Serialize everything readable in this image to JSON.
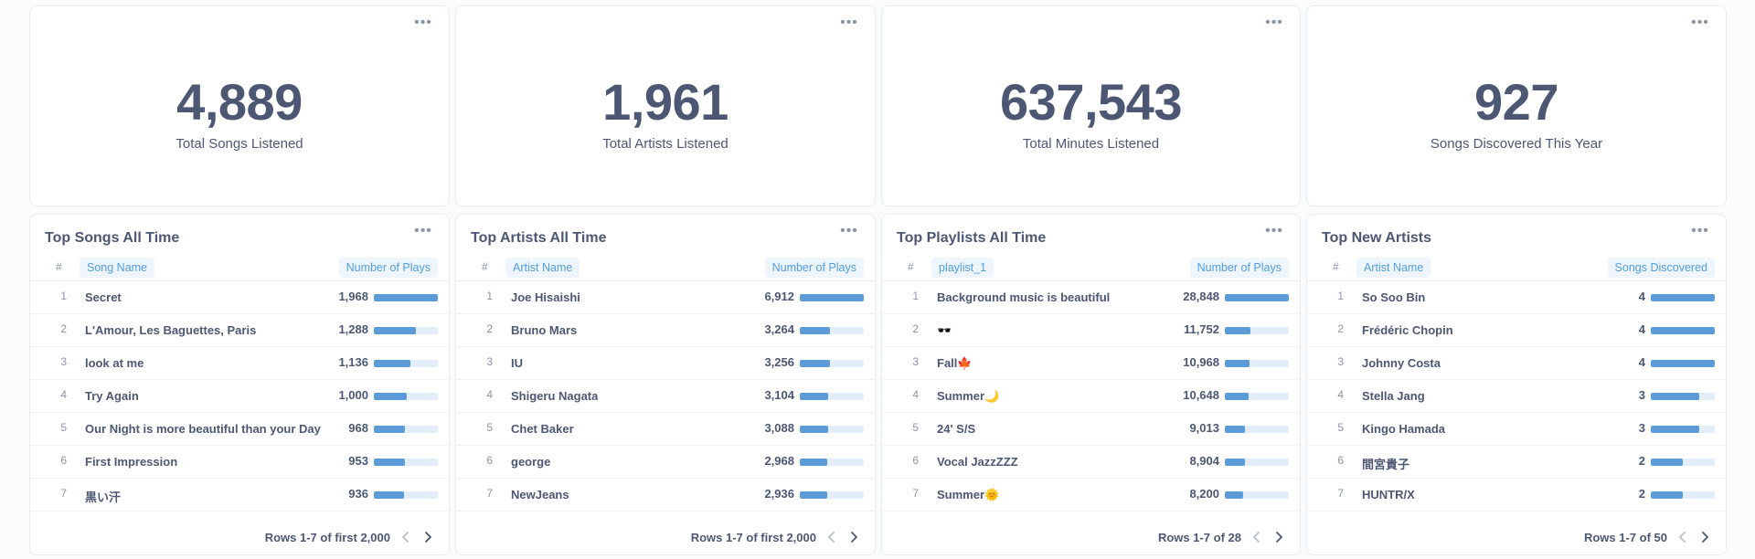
{
  "metrics": [
    {
      "value": "4,889",
      "label": "Total Songs Listened"
    },
    {
      "value": "1,961",
      "label": "Total Artists Listened"
    },
    {
      "value": "637,543",
      "label": "Total Minutes Listened"
    },
    {
      "value": "927",
      "label": "Songs Discovered This Year"
    }
  ],
  "more_icon": "more-horizontal-icon",
  "accent_color": "#509ee3",
  "bar_color": "#5b9bd8",
  "tables": [
    {
      "title": "Top Songs All Time",
      "num_header": "#",
      "name_header": "Song Name",
      "value_header": "Number of Plays",
      "rows": [
        {
          "idx": "1",
          "name": "Secret",
          "value": "1,968",
          "fraction": 1.0
        },
        {
          "idx": "2",
          "name": "L'Amour, Les Baguettes, Paris",
          "value": "1,288",
          "fraction": 0.654
        },
        {
          "idx": "3",
          "name": "look at me",
          "value": "1,136",
          "fraction": 0.577
        },
        {
          "idx": "4",
          "name": "Try Again",
          "value": "1,000",
          "fraction": 0.508
        },
        {
          "idx": "5",
          "name": "Our Night is more beautiful than your Day",
          "value": "968",
          "fraction": 0.492
        },
        {
          "idx": "6",
          "name": "First Impression",
          "value": "953",
          "fraction": 0.484
        },
        {
          "idx": "7",
          "name": "黒い汗",
          "value": "936",
          "fraction": 0.476
        }
      ],
      "footer": "Rows 1-7 of first 2,000"
    },
    {
      "title": "Top Artists All Time",
      "num_header": "#",
      "name_header": "Artist Name",
      "value_header": "Number of Plays",
      "rows": [
        {
          "idx": "1",
          "name": "Joe Hisaishi",
          "value": "6,912",
          "fraction": 1.0
        },
        {
          "idx": "2",
          "name": "Bruno Mars",
          "value": "3,264",
          "fraction": 0.472
        },
        {
          "idx": "3",
          "name": "IU",
          "value": "3,256",
          "fraction": 0.471
        },
        {
          "idx": "4",
          "name": "Shigeru Nagata",
          "value": "3,104",
          "fraction": 0.449
        },
        {
          "idx": "5",
          "name": "Chet Baker",
          "value": "3,088",
          "fraction": 0.447
        },
        {
          "idx": "6",
          "name": "george",
          "value": "2,968",
          "fraction": 0.429
        },
        {
          "idx": "7",
          "name": "NewJeans",
          "value": "2,936",
          "fraction": 0.425
        }
      ],
      "footer": "Rows 1-7 of first 2,000"
    },
    {
      "title": "Top Playlists All Time",
      "num_header": "#",
      "name_header": "playlist_1",
      "value_header": "Number of Plays",
      "rows": [
        {
          "idx": "1",
          "name": "Background music is beautiful",
          "value": "28,848",
          "fraction": 1.0
        },
        {
          "idx": "2",
          "name": "🕶️",
          "value": "11,752",
          "fraction": 0.407
        },
        {
          "idx": "3",
          "name": "Fall🍁",
          "value": "10,968",
          "fraction": 0.38
        },
        {
          "idx": "4",
          "name": "Summer🌙",
          "value": "10,648",
          "fraction": 0.369
        },
        {
          "idx": "5",
          "name": "24' S/S",
          "value": "9,013",
          "fraction": 0.312
        },
        {
          "idx": "6",
          "name": "Vocal JazzZZZ",
          "value": "8,904",
          "fraction": 0.309
        },
        {
          "idx": "7",
          "name": "Summer🌞",
          "value": "8,200",
          "fraction": 0.284
        }
      ],
      "footer": "Rows 1-7 of 28"
    },
    {
      "title": "Top New Artists",
      "num_header": "#",
      "name_header": "Artist Name",
      "value_header": "Songs Discovered",
      "rows": [
        {
          "idx": "1",
          "name": "So Soo Bin",
          "value": "4",
          "fraction": 1.0
        },
        {
          "idx": "2",
          "name": "Frédéric Chopin",
          "value": "4",
          "fraction": 1.0
        },
        {
          "idx": "3",
          "name": "Johnny Costa",
          "value": "4",
          "fraction": 1.0
        },
        {
          "idx": "4",
          "name": "Stella Jang",
          "value": "3",
          "fraction": 0.75
        },
        {
          "idx": "5",
          "name": "Kingo Hamada",
          "value": "3",
          "fraction": 0.75
        },
        {
          "idx": "6",
          "name": "間宮貴子",
          "value": "2",
          "fraction": 0.5
        },
        {
          "idx": "7",
          "name": "HUNTR/X",
          "value": "2",
          "fraction": 0.5
        }
      ],
      "footer": "Rows 1-7 of 50"
    }
  ]
}
